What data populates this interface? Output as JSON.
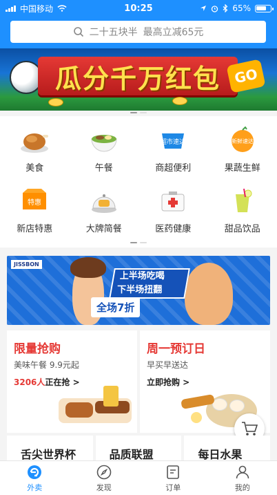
{
  "status": {
    "carrier": "中国移动",
    "time": "10:25",
    "battery": "65%"
  },
  "search": {
    "placeholder_left": "二十五块半",
    "placeholder_right": "最高立减65元"
  },
  "banner": {
    "title": "瓜分千万红包",
    "go": "GO"
  },
  "categories": [
    {
      "label": "美食",
      "icon": "roast-chicken-icon"
    },
    {
      "label": "午餐",
      "icon": "lunch-bowl-icon"
    },
    {
      "label": "商超便利",
      "icon": "supermarket-icon",
      "badge": "超市速达"
    },
    {
      "label": "果蔬生鲜",
      "icon": "fresh-produce-icon",
      "badge": "新鲜速达"
    },
    {
      "label": "新店特惠",
      "icon": "new-store-icon",
      "badge": "特惠"
    },
    {
      "label": "大牌简餐",
      "icon": "brand-meal-icon"
    },
    {
      "label": "医药健康",
      "icon": "medicine-kit-icon"
    },
    {
      "label": "甜品饮品",
      "icon": "dessert-drink-icon"
    }
  ],
  "promo": {
    "brand": "JISSBON",
    "line1": "上半场吃喝",
    "line2": "下半场扭翻",
    "discount": "全场7折"
  },
  "cards": [
    {
      "title": "限量抢购",
      "title_color": "#e53935",
      "sub": "美味午餐 9.9元起",
      "cta_count": "3206人",
      "cta_text": "正在抢 >"
    },
    {
      "title": "周一预订日",
      "title_color": "#e53935",
      "sub": "早买早送达",
      "cta_count": "",
      "cta_text": "立即抢购 >"
    }
  ],
  "row3": [
    "舌尖世界杯",
    "品质联盟",
    "每日水果"
  ],
  "tabs": [
    {
      "label": "外卖",
      "icon": "takeout-icon",
      "active": true
    },
    {
      "label": "发现",
      "icon": "compass-icon",
      "active": false
    },
    {
      "label": "订单",
      "icon": "order-icon",
      "active": false
    },
    {
      "label": "我的",
      "icon": "profile-icon",
      "active": false
    }
  ],
  "colors": {
    "accent": "#1e90ff",
    "sale": "#e53935"
  }
}
